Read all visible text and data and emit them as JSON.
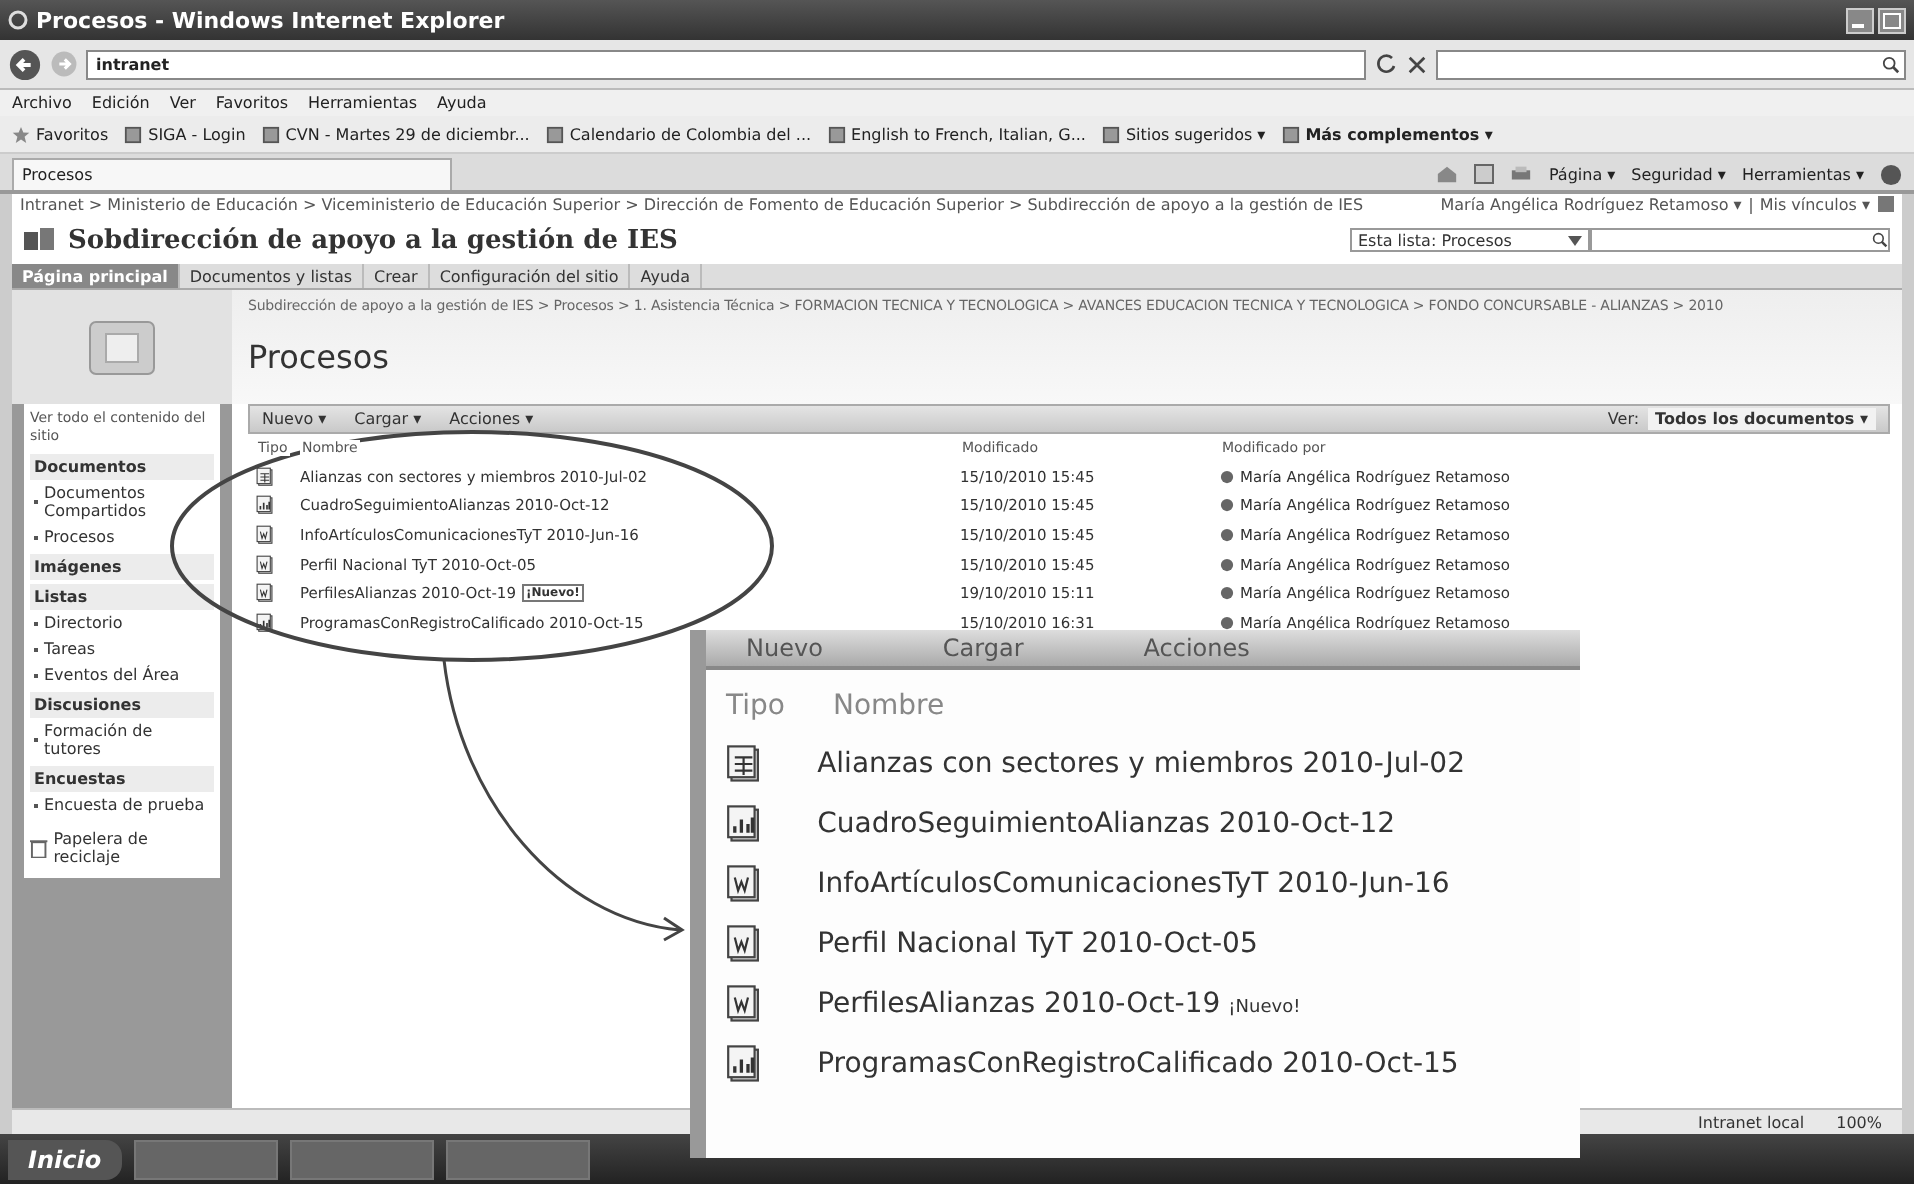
{
  "window": {
    "title": "Procesos - Windows Internet Explorer"
  },
  "address_bar": {
    "value": "intranet"
  },
  "menu": [
    "Archivo",
    "Edición",
    "Ver",
    "Favoritos",
    "Herramientas",
    "Ayuda"
  ],
  "favorites_bar": [
    {
      "label": "Favoritos",
      "kind": "star"
    },
    {
      "label": "SIGA - Login",
      "kind": "page"
    },
    {
      "label": "CVN - Martes 29 de diciembr...",
      "kind": "page"
    },
    {
      "label": "Calendario de Colombia del ...",
      "kind": "page"
    },
    {
      "label": "English to French, Italian, G...",
      "kind": "page"
    },
    {
      "label": "Sitios sugeridos ▾",
      "kind": "page"
    },
    {
      "label": "Más complementos ▾",
      "kind": "bold"
    }
  ],
  "browser_tabs": [
    {
      "label": "Procesos",
      "selected": true
    }
  ],
  "command_bar": [
    "Página ▾",
    "Seguridad ▾",
    "Herramientas ▾"
  ],
  "site": {
    "breadcrumb": "Intranet > Ministerio de Educación > Viceministerio de Educación Superior > Dirección de Fomento de Educación Superior > Subdirección de apoyo a la gestión de IES",
    "user": "María Angélica Rodríguez Retamoso ▾",
    "my_links": "Mis vínculos ▾",
    "title": "Sobdirección de apoyo a la gestión de IES",
    "search_scope": "Esta lista: Procesos",
    "nav_tabs": [
      {
        "label": "Página principal",
        "selected": true
      },
      {
        "label": "Documentos y listas",
        "selected": false
      },
      {
        "label": "Crear",
        "selected": false
      },
      {
        "label": "Configuración del sitio",
        "selected": false
      },
      {
        "label": "Ayuda",
        "selected": false
      }
    ],
    "path": "Subdirección de apoyo a la gestión de IES > Procesos > 1. Asistencia Técnica > FORMACION TECNICA Y TECNOLOGICA > AVANCES EDUCACION TECNICA Y TECNOLOGICA > FONDO CONCURSABLE - ALIANZAS > 2010",
    "page_title": "Procesos"
  },
  "sidebar": {
    "view_all": "Ver todo el contenido del sitio",
    "sections": [
      {
        "heading": "Documentos",
        "items": [
          "Documentos Compartidos",
          "Procesos"
        ]
      },
      {
        "heading": "Imágenes"
      },
      {
        "heading": "Listas",
        "items": [
          "Directorio",
          "Tareas",
          "Eventos del Área"
        ]
      },
      {
        "heading": "Discusiones",
        "items": [
          "Formación de tutores"
        ]
      },
      {
        "heading": "Encuestas",
        "items": [
          "Encuesta de prueba"
        ]
      }
    ],
    "recycle_bin": "Papelera de reciclaje"
  },
  "toolbar": {
    "actions": [
      "Nuevo ▾",
      "Cargar ▾",
      "Acciones ▾"
    ],
    "view_label": "Ver:",
    "view_value": "Todos los documentos ▾"
  },
  "list": {
    "columns": [
      "Tipo",
      "Nombre",
      "Modificado",
      "Modificado por"
    ],
    "rows": [
      {
        "kind": "sheet",
        "name": "Alianzas con sectores y miembros 2010-Jul-02",
        "modified": "15/10/2010 15:45",
        "modified_by": "María Angélica Rodríguez Retamoso"
      },
      {
        "kind": "chart",
        "name": "CuadroSeguimientoAlianzas 2010-Oct-12",
        "modified": "15/10/2010 15:45",
        "modified_by": "María Angélica Rodríguez Retamoso"
      },
      {
        "kind": "word",
        "name": "InfoArtículosComunicacionesTyT 2010-Jun-16",
        "modified": "15/10/2010 15:45",
        "modified_by": "María Angélica Rodríguez Retamoso"
      },
      {
        "kind": "word",
        "name": "Perfil Nacional TyT 2010-Oct-05",
        "modified": "15/10/2010 15:45",
        "modified_by": "María Angélica Rodríguez Retamoso"
      },
      {
        "kind": "word",
        "name": "PerfilesAlianzas 2010-Oct-19",
        "badge": "¡Nuevo!",
        "modified": "19/10/2010 15:11",
        "modified_by": "María Angélica Rodríguez Retamoso"
      },
      {
        "kind": "chart",
        "name": "ProgramasConRegistroCalificado 2010-Oct-15",
        "modified": "15/10/2010 16:31",
        "modified_by": "María Angélica Rodríguez Retamoso"
      }
    ]
  },
  "inset": {
    "actions": [
      "Nuevo",
      "Cargar",
      "Acciones"
    ],
    "columns": [
      "Tipo",
      "Nombre"
    ],
    "rows": [
      {
        "kind": "sheet",
        "name": "Alianzas con sectores y miembros 2010-Jul-02"
      },
      {
        "kind": "chart",
        "name": "CuadroSeguimientoAlianzas 2010-Oct-12"
      },
      {
        "kind": "word",
        "name": "InfoArtículosComunicacionesTyT 2010-Jun-16"
      },
      {
        "kind": "word",
        "name": "Perfil Nacional TyT 2010-Oct-05"
      },
      {
        "kind": "word",
        "name": "PerfilesAlianzas 2010-Oct-19",
        "badge": "¡Nuevo!"
      },
      {
        "kind": "chart",
        "name": "ProgramasConRegistroCalificado 2010-Oct-15"
      }
    ]
  },
  "status_bar": {
    "zone": "Intranet local",
    "zoom": "100%"
  },
  "taskbar": {
    "start": "Inicio"
  }
}
